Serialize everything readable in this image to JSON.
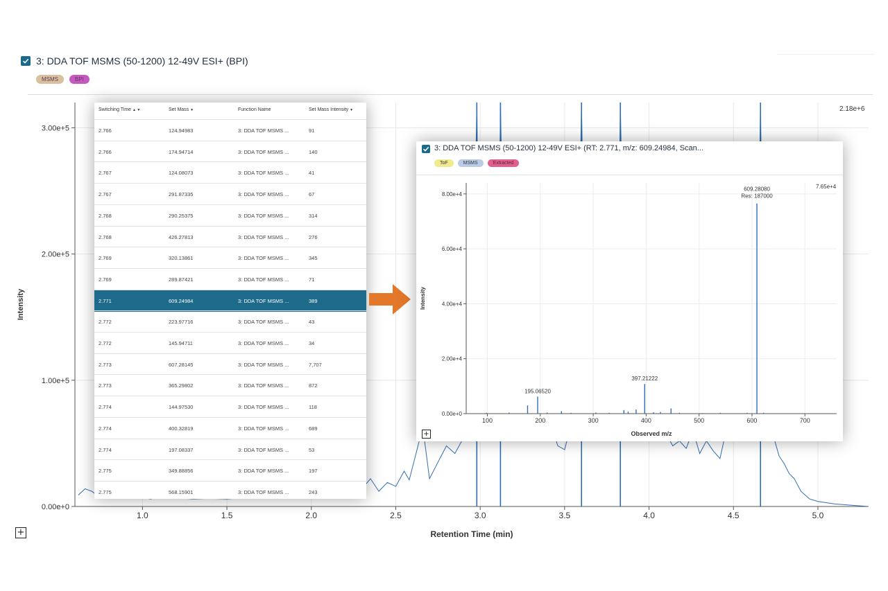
{
  "main_trace": {
    "title": "3: DDA TOF MSMS (50-1200) 12-49V ESI+ (BPI)",
    "chips": [
      {
        "label": "MSMS",
        "color": "#d8c0a0"
      },
      {
        "label": "BPI",
        "color": "#c45ac0"
      }
    ],
    "max_label": "2.18e+6",
    "expand_symbol": "+"
  },
  "spectrum_popup": {
    "title": "3: DDA TOF MSMS (50-1200) 12-49V ESI+ (RT: 2.771, m/z: 609.24984, Scan...",
    "chips": [
      {
        "label": "ToF",
        "color": "#f1ea8e"
      },
      {
        "label": "MSMS",
        "color": "#b9cbe6"
      },
      {
        "label": "Extracted",
        "color": "#e05f8e"
      }
    ],
    "max_label": "7.65e+4",
    "expand_symbol": "+"
  },
  "table": {
    "headers": [
      "Switching Time",
      "Set Mass",
      "Function Name",
      "Set Mass Intensity"
    ],
    "sort_icons": [
      "▲ ▼",
      "▼",
      "",
      "▼"
    ],
    "selected_index": 8,
    "rows": [
      [
        "2.766",
        "124.94983",
        "3: DDA TOF MSMS ...",
        "91"
      ],
      [
        "2.766",
        "174.94714",
        "3: DDA TOF MSMS ...",
        "140"
      ],
      [
        "2.767",
        "124.08073",
        "3: DDA TOF MSMS ...",
        "41"
      ],
      [
        "2.767",
        "291.87335",
        "3: DDA TOF MSMS ...",
        "67"
      ],
      [
        "2.768",
        "290.25375",
        "3: DDA TOF MSMS ...",
        "314"
      ],
      [
        "2.768",
        "426.27813",
        "3: DDA TOF MSMS ...",
        "276"
      ],
      [
        "2.769",
        "320.13861",
        "3: DDA TOF MSMS ...",
        "345"
      ],
      [
        "2.769",
        "289.87421",
        "3: DDA TOF MSMS ...",
        "71"
      ],
      [
        "2.771",
        "609.24984",
        "3: DDA TOF MSMS ...",
        "389"
      ],
      [
        "2.772",
        "223.97716",
        "3: DDA TOF MSMS ...",
        "43"
      ],
      [
        "2.772",
        "145.94711",
        "3: DDA TOF MSMS ...",
        "34"
      ],
      [
        "2.773",
        "607.28145",
        "3: DDA TOF MSMS ...",
        "7,707"
      ],
      [
        "2.773",
        "365.29802",
        "3: DDA TOF MSMS ...",
        "872"
      ],
      [
        "2.774",
        "144.97530",
        "3: DDA TOF MSMS ...",
        "118"
      ],
      [
        "2.774",
        "400.32819",
        "3: DDA TOF MSMS ...",
        "689"
      ],
      [
        "2.774",
        "197.08337",
        "3: DDA TOF MSMS ...",
        "53"
      ],
      [
        "2.775",
        "349.88856",
        "3: DDA TOF MSMS ...",
        "197"
      ],
      [
        "2.775",
        "568.15901",
        "3: DDA TOF MSMS ...",
        "243"
      ]
    ]
  },
  "chart_data": [
    {
      "type": "line",
      "title": "3: DDA TOF MSMS (50-1200) 12-49V ESI+ (BPI)",
      "xlabel": "Retention Time (min)",
      "ylabel": "Intensity",
      "xlim": [
        0.6,
        5.3
      ],
      "ylim": [
        0,
        320000
      ],
      "x_ticks": [
        "1.0",
        "1.5",
        "2.0",
        "2.5",
        "3.0",
        "3.5",
        "4.0",
        "4.5",
        "5.0"
      ],
      "y_ticks": [
        "0.00e+0",
        "1.00e+5",
        "2.00e+5",
        "3.00e+5"
      ],
      "color": "#2f6eb5",
      "tall_peaks_rt": [
        2.98,
        3.12,
        3.6,
        3.83,
        4.66
      ],
      "series": [
        {
          "x": [
            0.62,
            0.66,
            0.7,
            0.74,
            0.78,
            0.8,
            0.84,
            0.88,
            0.92,
            0.96,
            1.0,
            1.05,
            1.1,
            1.15,
            1.2,
            1.3,
            1.4,
            1.5,
            1.6,
            1.7,
            1.8,
            1.9,
            2.0,
            2.1,
            2.2,
            2.3,
            2.35,
            2.4,
            2.45,
            2.5,
            2.55,
            2.58,
            2.62,
            2.66,
            2.7,
            2.75,
            2.8,
            2.85,
            2.9,
            2.93,
            2.95,
            2.98,
            3.0,
            3.02,
            3.05,
            3.08,
            3.1,
            3.12,
            3.15,
            3.18,
            3.22,
            3.26,
            3.3,
            3.34,
            3.38,
            3.42,
            3.46,
            3.5,
            3.54,
            3.57,
            3.6,
            3.63,
            3.66,
            3.7,
            3.74,
            3.78,
            3.81,
            3.83,
            3.86,
            3.9,
            3.94,
            3.98,
            4.02,
            4.06,
            4.1,
            4.14,
            4.18,
            4.22,
            4.26,
            4.3,
            4.34,
            4.38,
            4.42,
            4.46,
            4.5,
            4.53,
            4.56,
            4.59,
            4.62,
            4.64,
            4.66,
            4.68,
            4.71,
            4.74,
            4.77,
            4.8,
            4.83,
            4.86,
            4.9,
            4.95,
            5.0,
            5.1,
            5.2,
            5.3
          ],
          "y": [
            9000,
            14000,
            12000,
            8000,
            18000,
            58000,
            11000,
            9000,
            10000,
            8000,
            7000,
            6000,
            8000,
            6500,
            7000,
            6000,
            6500,
            6000,
            7000,
            6500,
            7500,
            7000,
            8000,
            9000,
            11000,
            14000,
            22000,
            12000,
            19000,
            16000,
            28000,
            21000,
            42000,
            63000,
            22000,
            35000,
            48000,
            42000,
            54000,
            95000,
            78000,
            320000,
            88000,
            96000,
            72000,
            80000,
            66000,
            320000,
            90000,
            74000,
            60000,
            70000,
            54000,
            66000,
            58000,
            64000,
            48000,
            45000,
            66000,
            70000,
            320000,
            72000,
            58000,
            54000,
            66000,
            76000,
            86000,
            320000,
            92000,
            70000,
            82000,
            58000,
            95000,
            70000,
            58000,
            48000,
            52000,
            46000,
            60000,
            42000,
            52000,
            44000,
            38000,
            62000,
            56000,
            74000,
            68000,
            60000,
            70000,
            120000,
            320000,
            110000,
            72000,
            54000,
            40000,
            34000,
            26000,
            22000,
            12000,
            6000,
            4000,
            2000,
            1000,
            0
          ]
        }
      ]
    },
    {
      "type": "bar",
      "title": "3: DDA TOF MSMS (50-1200) 12-49V ESI+ (RT: 2.771, m/z: 609.24984, Scan...",
      "xlabel": "Observed m/z",
      "ylabel": "Intensity",
      "xlim": [
        60,
        760
      ],
      "ylim": [
        0,
        84000
      ],
      "x_ticks": [
        "100",
        "200",
        "300",
        "400",
        "500",
        "600",
        "700"
      ],
      "y_ticks": [
        "0.00e+0",
        "2.00e+4",
        "4.00e+4",
        "6.00e+4",
        "8.00e+4"
      ],
      "color": "#2f6eb5",
      "x": [
        98,
        141,
        176,
        195.0652,
        213,
        240,
        258,
        305,
        330,
        358,
        366,
        381,
        397.21222,
        414,
        427,
        447,
        463,
        507,
        540,
        591,
        609.2808,
        622
      ],
      "y": [
        300,
        400,
        3000,
        6200,
        400,
        900,
        300,
        400,
        300,
        1300,
        700,
        1500,
        10800,
        500,
        600,
        1900,
        300,
        200,
        300,
        300,
        76500,
        300
      ],
      "annotations": [
        {
          "x": 195.0652,
          "y": 6200,
          "text": "195.06520"
        },
        {
          "x": 397.21222,
          "y": 10800,
          "text": "397.21222"
        },
        {
          "x": 609.2808,
          "y": 76500,
          "text": "609.28080"
        },
        {
          "x": 609.2808,
          "y": 76500,
          "text": "Res: 187000"
        }
      ]
    }
  ]
}
